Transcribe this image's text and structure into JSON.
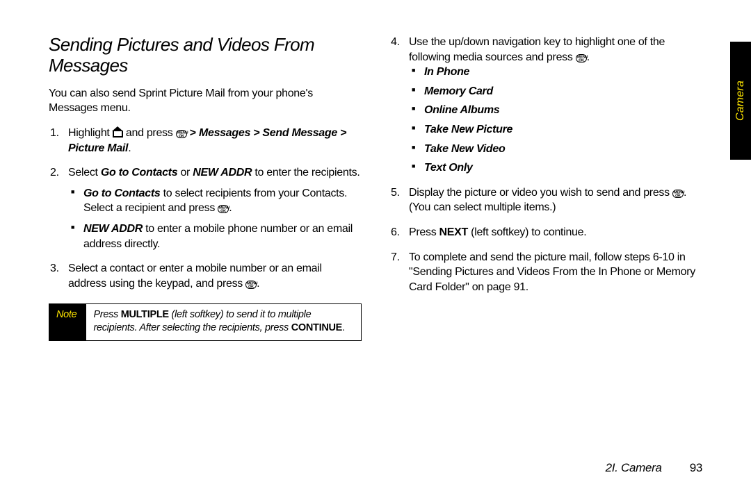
{
  "side_tab": "Camera",
  "title": "Sending Pictures and Videos From Messages",
  "intro": "You can also send Sprint Picture Mail from your phone's Messages menu.",
  "step1": {
    "a": "Highlight ",
    "b": " and press ",
    "path": "Messages > Send Message > Picture Mail",
    "end": "."
  },
  "step2": {
    "lead": "Select ",
    "g": "Go to Contacts",
    "mid": " or ",
    "n": "NEW ADDR",
    "tail": " to enter the recipients.",
    "sub_g_a": "Go to Contacts",
    "sub_g_b": " to select recipients from your Contacts. Select a recipient and press ",
    "sub_g_c": ".",
    "sub_n_a": "NEW ADDR",
    "sub_n_b": " to enter a mobile phone number or an email address directly."
  },
  "step3": {
    "a": "Select a contact or enter a mobile number or an email address using the keypad, and press ",
    "b": "."
  },
  "note": {
    "label": "Note",
    "a": "Press ",
    "m": "MULTIPLE",
    "b": " (left softkey) to send it to multiple recipients. After selecting the recipients, press ",
    "c": "CONTINUE",
    "d": "."
  },
  "step4": {
    "a": "Use the up/down navigation key to highlight one of the following media sources and press ",
    "b": "."
  },
  "media": [
    "In Phone",
    "Memory Card",
    "Online Albums",
    "Take New Picture",
    "Take New Video",
    "Text Only"
  ],
  "step5": {
    "a": "Display the picture or video you wish to send and press ",
    "b": ". (You can select multiple items.)"
  },
  "step6": {
    "a": "Press ",
    "n": "NEXT",
    "b": " (left softkey) to continue."
  },
  "step7": "To complete and send the picture mail, follow steps 6-10 in \"Sending Pictures and Videos From the In Phone or Memory Card Folder\" on page 91.",
  "footer": {
    "section": "2I. Camera",
    "page": "93"
  }
}
